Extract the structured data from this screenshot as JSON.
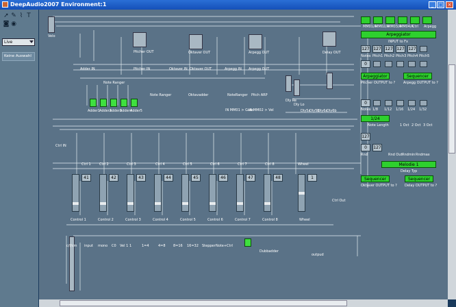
{
  "window": {
    "title": "DeepAudio2007 Environment:1",
    "minimize": "_",
    "maximize": "□",
    "close": "×"
  },
  "sidebar": {
    "layer_select": "Live",
    "thru_label": "Keine Auswahl"
  },
  "canvas": {
    "top_labels": [
      "Velo",
      "Adder IN",
      "Ctrl IN"
    ],
    "outs": [
      "Pitcher OUT",
      "Oktaver OUT",
      "Arpegg OUT",
      "Delay OUT"
    ],
    "outs_lower": [
      "Pitcher IN",
      "Oktaver IN",
      "Arpegg IN",
      "Arpegg IN"
    ],
    "note_ranger": "Note Ranger",
    "adders": [
      "Adder1",
      "Adder2",
      "Adder3",
      "Adder4",
      "Adder5"
    ],
    "mid_labels": [
      "Note Ranger",
      "Oktavadder",
      "NoteRanger",
      "Pitch ARP",
      "IN MM01 > Gate",
      "IN MM02 > Vel"
    ],
    "dly_labels": [
      "Dly Re",
      "Dly Lo",
      "Dly5a",
      "Dly5b",
      "Dly6a",
      "Dly6b"
    ],
    "ctrls": [
      "Ctrl 1",
      "Ctrl 2",
      "Ctrl 3",
      "Ctrl 4",
      "Ctrl 5",
      "Ctrl 6",
      "Ctrl 7",
      "Ctrl 8"
    ],
    "wheel": "Wheel",
    "ctrl_values": [
      "41",
      "42",
      "43",
      "44",
      "45",
      "46",
      "47",
      "48"
    ],
    "wheel_value": "1",
    "controls": [
      "Control 1",
      "Control 2",
      "Control 3",
      "Control 4",
      "Control 5",
      "Control 6",
      "Control 7",
      "Control 8"
    ],
    "ctrl_out": "Ctrl Out",
    "bottom_labels": [
      "c/f/cm",
      "input",
      "mono",
      "C0",
      "Vel 1",
      "1",
      "1=4",
      "4=8",
      "8=16",
      "16=32",
      "Stepper",
      "Note+Ctrl",
      "Dubbadder",
      "outpud"
    ]
  },
  "right_panel": {
    "top_buttons": [
      "MM01/A",
      "MM02/A",
      "MM03/A",
      "MM04/A",
      "Ctrl",
      "Arpegg"
    ],
    "arpeggiator": "Arpeggiator",
    "input_fx": "INPUT to Fx",
    "row1_labels": [
      "Notes",
      "Pitch1",
      "Pitch2",
      "Pitch3",
      "Pitch4",
      "Pitch5"
    ],
    "row1_values": [
      "127",
      "127",
      "127",
      "127",
      "127"
    ],
    "row2_labels": [
      "Arp",
      "1/16",
      "Up",
      "Ctrl",
      "1/8",
      "Rnd"
    ],
    "row2_values": [
      "0"
    ],
    "pitcher_out": "Pitcher OUTPUT to ?",
    "arpegg_out": "Arpegg OUTPUT to ?",
    "sel1": "Arpeggiator",
    "sel2": "Sequencer",
    "row3_labels": [
      "Notes",
      "1/8",
      "1/12",
      "1/16",
      "1/24",
      "1/32"
    ],
    "row3_values": [
      "0",
      "1/8"
    ],
    "note_length": "Note Length",
    "note_length_value": "1/24",
    "row4_labels": [
      "1 Oct",
      "2 Oct",
      "3 Oct"
    ],
    "row5_labels": [
      "Rnd",
      "Rnd Out",
      "Rndmin",
      "Rndmax",
      "Rnd"
    ],
    "row5_values": [
      "127",
      "0",
      "127"
    ],
    "melodie": "Melodie 1",
    "delay_typ": "Delay Typ",
    "oktaver_out": "Oktaver OUTPUT to ?",
    "delay_out": "Delay OUTPUT to ?",
    "sel3": "Sequencer",
    "sel4": "Sequencer"
  }
}
